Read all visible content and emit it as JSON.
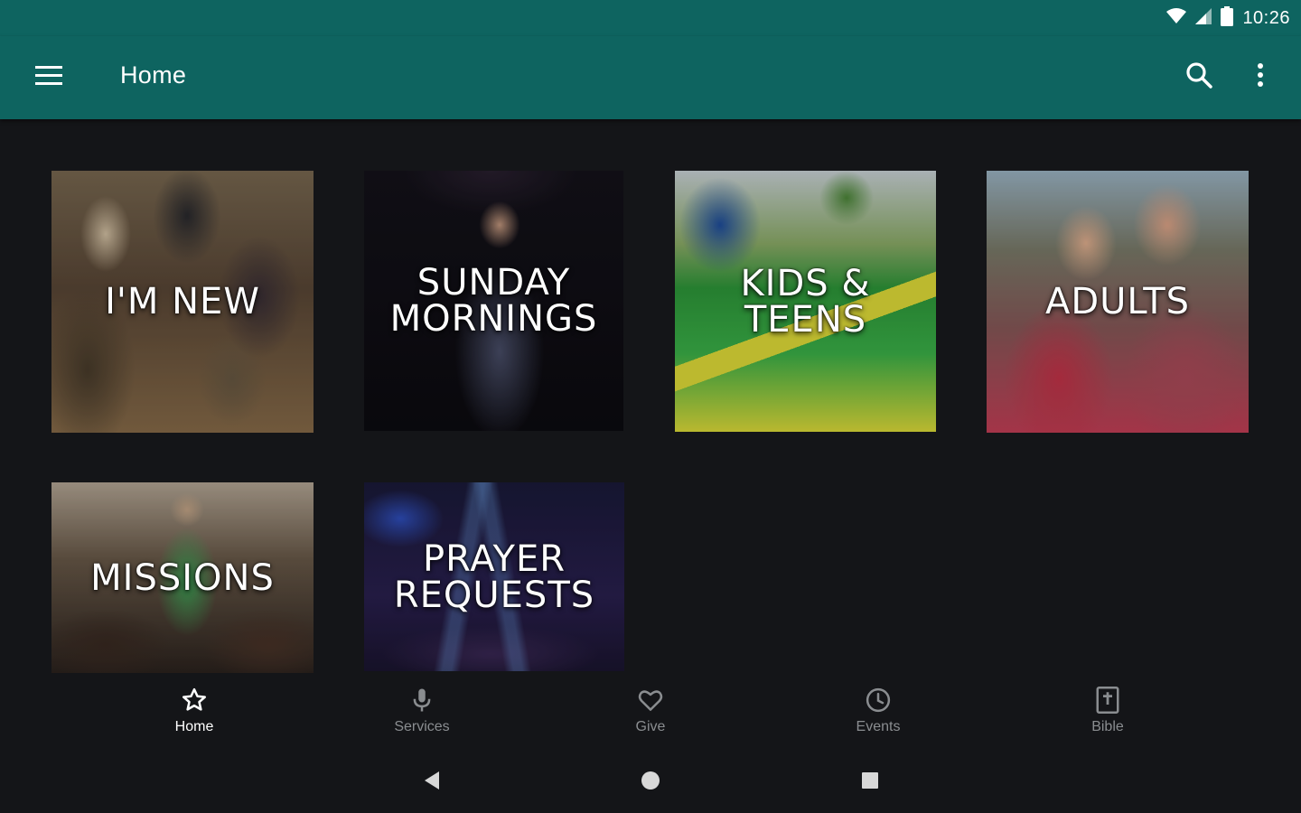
{
  "status_bar": {
    "time": "10:26"
  },
  "app_bar": {
    "title": "Home"
  },
  "tiles": [
    {
      "label": "I'M NEW"
    },
    {
      "label": "SUNDAY\nMORNINGS"
    },
    {
      "label": "KIDS & TEENS"
    },
    {
      "label": "ADULTS"
    },
    {
      "label": "MISSIONS"
    },
    {
      "label": "PRAYER\nREQUESTS"
    }
  ],
  "bottom_nav": {
    "items": [
      {
        "label": "Home",
        "icon": "star-icon",
        "active": true
      },
      {
        "label": "Services",
        "icon": "microphone-icon",
        "active": false
      },
      {
        "label": "Give",
        "icon": "heart-icon",
        "active": false
      },
      {
        "label": "Events",
        "icon": "clock-icon",
        "active": false
      },
      {
        "label": "Bible",
        "icon": "bible-icon",
        "active": false
      }
    ]
  },
  "colors": {
    "primary": "#0e6460",
    "background": "#141518",
    "nav_inactive": "#8a8d90",
    "nav_active": "#ffffff"
  }
}
